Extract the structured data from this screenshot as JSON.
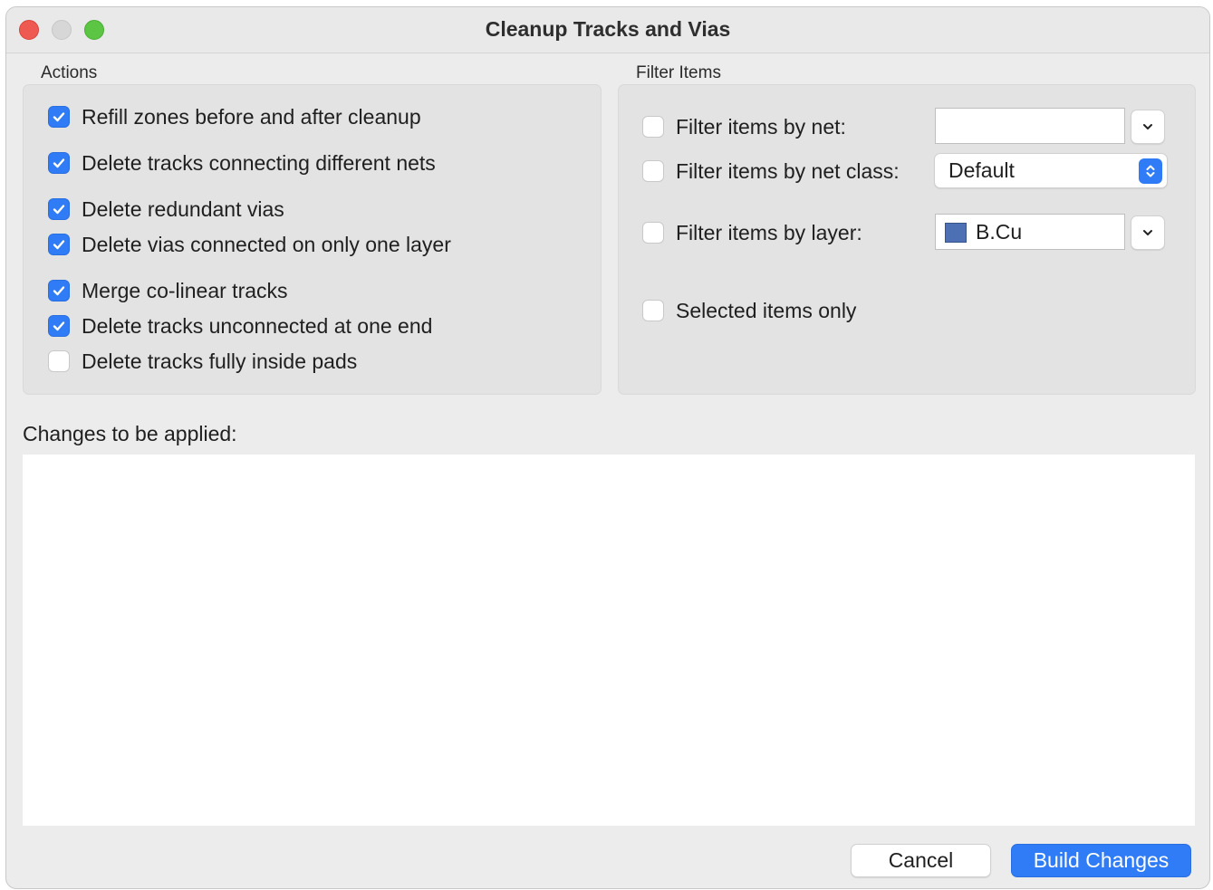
{
  "window": {
    "title": "Cleanup Tracks and Vias"
  },
  "actions": {
    "label": "Actions",
    "items": [
      {
        "label": "Refill zones before and after cleanup",
        "checked": true
      },
      {
        "label": "Delete tracks connecting different nets",
        "checked": true
      },
      {
        "label": "Delete redundant vias",
        "checked": true
      },
      {
        "label": "Delete vias connected on only one layer",
        "checked": true
      },
      {
        "label": "Merge co-linear tracks",
        "checked": true
      },
      {
        "label": "Delete tracks unconnected at one end",
        "checked": true
      },
      {
        "label": "Delete tracks fully inside pads",
        "checked": false
      }
    ]
  },
  "filter": {
    "label": "Filter Items",
    "by_net": {
      "label": "Filter items by net:",
      "checked": false,
      "value": ""
    },
    "by_net_class": {
      "label": "Filter items by net class:",
      "checked": false,
      "value": "Default"
    },
    "by_layer": {
      "label": "Filter items by layer:",
      "checked": false,
      "value": "B.Cu",
      "swatch_color": "#4d6fb4"
    },
    "selected_only": {
      "label": "Selected items only",
      "checked": false
    }
  },
  "changes": {
    "label": "Changes to be applied:"
  },
  "buttons": {
    "cancel": "Cancel",
    "build": "Build Changes"
  },
  "colors": {
    "accent": "#2f7cf6",
    "window_bg": "#ececec",
    "close": "#ee5a52",
    "maximize": "#5cc544"
  }
}
